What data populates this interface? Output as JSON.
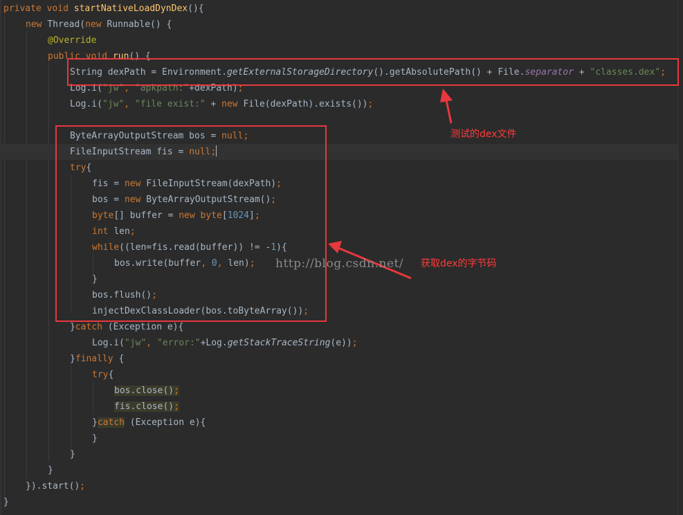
{
  "code_lines": [
    "private void startNativeLoadDynDex(){",
    "new Thread(new Runnable() {",
    "@Override",
    "public void run() {",
    "String dexPath = Environment.getExternalStorageDirectory().getAbsolutePath() + File.separator + \"classes.dex\";",
    "Log.i(\"jw\", \"apkpath:\"+dexPath);",
    "Log.i(\"jw\", \"file exist:\" + new File(dexPath).exists());",
    "",
    "ByteArrayOutputStream bos = null;",
    "FileInputStream fis = null;",
    "try{",
    "fis = new FileInputStream(dexPath);",
    "bos = new ByteArrayOutputStream();",
    "byte[] buffer = new byte[1024];",
    "int len;",
    "while((len=fis.read(buffer)) != -1){",
    "bos.write(buffer, 0, len);",
    "}",
    "bos.flush();",
    "injectDexClassLoader(bos.toByteArray());",
    "}catch (Exception e){",
    "Log.i(\"jw\", \"error:\"+Log.getStackTraceString(e));",
    "}finally {",
    "try{",
    "bos.close();",
    "fis.close();",
    "}catch (Exception e){",
    "}",
    "}",
    "}",
    "}).start();",
    "}"
  ],
  "annotations": {
    "dex_file_label": "测试的dex文件",
    "dex_bytes_label": "获取dex的字节码",
    "watermark": "http://blog.csdn.net/"
  },
  "colors": {
    "background": "#2b2b2b",
    "keyword": "#cc7832",
    "string": "#6a8759",
    "number": "#6897bb",
    "annotation": "#bbb529",
    "field": "#9876aa",
    "method": "#ffc66d",
    "text": "#a9b7c6",
    "highlight_box": "#e8383d"
  }
}
